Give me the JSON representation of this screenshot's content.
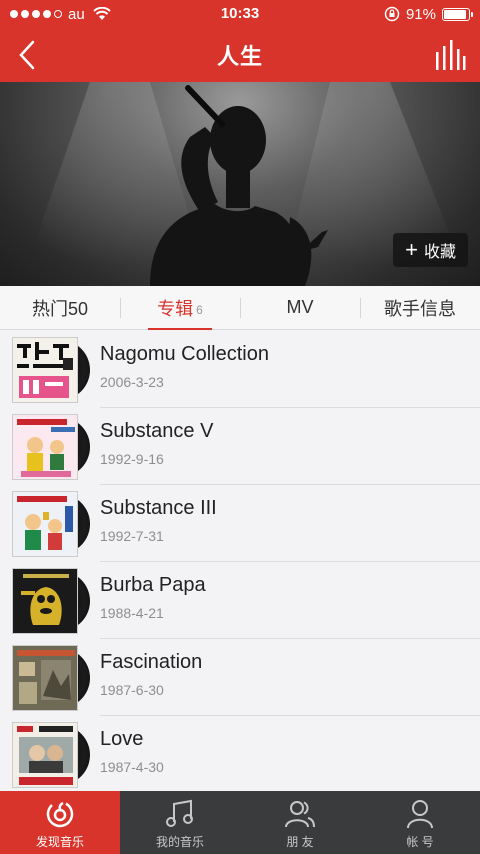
{
  "status_bar": {
    "carrier": "au",
    "time": "10:33",
    "battery": "91%",
    "battery_level": 0.91
  },
  "nav": {
    "title": "人生",
    "back_icon": "chevron-left-icon",
    "right_icon": "equalizer-icon"
  },
  "hero": {
    "favorite_label": "收藏",
    "favorite_icon": "plus-icon"
  },
  "tabs": [
    {
      "label": "热门50",
      "count": ""
    },
    {
      "label": "专辑",
      "count": "6"
    },
    {
      "label": "MV",
      "count": ""
    },
    {
      "label": "歌手信息",
      "count": ""
    }
  ],
  "albums": [
    {
      "title": "Nagomu Collection",
      "date": "2006-3-23"
    },
    {
      "title": "Substance V",
      "date": "1992-9-16"
    },
    {
      "title": "Substance III",
      "date": "1992-7-31"
    },
    {
      "title": "Burba Papa",
      "date": "1988-4-21"
    },
    {
      "title": "Fascination",
      "date": "1987-6-30"
    },
    {
      "title": "Love",
      "date": "1987-4-30"
    }
  ],
  "bottom_tabs": [
    {
      "label": "发现音乐",
      "icon": "netease-music-icon"
    },
    {
      "label": "我的音乐",
      "icon": "music-note-icon"
    },
    {
      "label": "朋 友",
      "icon": "friends-icon"
    },
    {
      "label": "帐 号",
      "icon": "account-icon"
    }
  ],
  "colors": {
    "brand_red": "#d8342b",
    "tabbar_bg": "#3a3b3d"
  }
}
